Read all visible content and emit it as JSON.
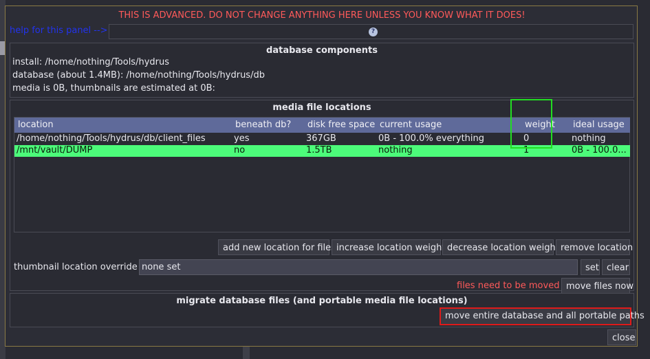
{
  "warning": "THIS IS ADVANCED. DO NOT CHANGE ANYTHING HERE UNLESS YOU KNOW WHAT IT DOES!",
  "help": {
    "link_text": "help for this panel -->",
    "icon": "question-icon",
    "icon_glyph": "?"
  },
  "database_components": {
    "title": "database components",
    "install": "install: /home/nothing/Tools/hydrus",
    "database": "database (about 1.4MB): /home/nothing/Tools/hydrus/db",
    "media": "media is 0B, thumbnails are estimated at 0B:"
  },
  "media_locations": {
    "title": "media file locations",
    "columns": [
      "location",
      "beneath db?",
      "disk free space",
      "current usage",
      "weight",
      "ideal usage"
    ],
    "rows": [
      [
        "/home/nothing/Tools/hydrus/db/client_files",
        "yes",
        "367GB",
        "0B - 100.0% everything",
        "0",
        "nothing"
      ],
      [
        "/mnt/vault/DUMP",
        "no",
        "1.5TB",
        "nothing",
        "1",
        "0B - 100.0..."
      ]
    ],
    "selected_row": 1,
    "buttons": {
      "add": "add new location for files",
      "increase": "increase location weight",
      "decrease": "decrease location weight",
      "remove": "remove location"
    },
    "thumbnail_label": "thumbnail location override",
    "thumbnail_value": "none set",
    "set_label": "set",
    "clear_label": "clear",
    "status": "files need to be moved",
    "move_files": "move files now"
  },
  "migrate": {
    "title": "migrate database files (and portable media file locations)",
    "button": "move entire database and all portable paths"
  },
  "close_label": "close",
  "colors": {
    "warning": "#ff5a5a",
    "help_link": "#2233ee",
    "header_bg": "#5f6a9a",
    "selected_row": "#4cfb7a",
    "highlight_green": "#22dd22",
    "highlight_red": "#e01a1a",
    "border_gold": "#8a7a45"
  }
}
